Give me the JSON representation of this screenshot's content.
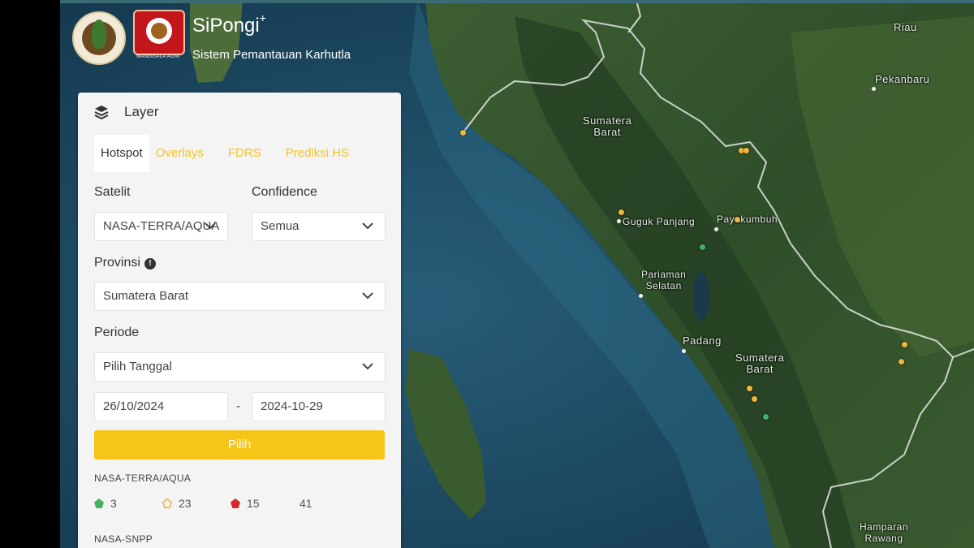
{
  "app": {
    "title": "SiPongi",
    "title_sup": "+",
    "subtitle": "Sistem Pemantauan Karhutla",
    "logo_manggala_caption": "MANGGALA AGNI"
  },
  "panel": {
    "title": "Layer",
    "tabs": [
      {
        "label": "Hotspot",
        "active": true
      },
      {
        "label": "Overlays",
        "active": false
      },
      {
        "label": "FDRS",
        "active": false
      },
      {
        "label": "Prediksi HS",
        "active": false
      }
    ],
    "satelit_label": "Satelit",
    "satelit_value": "NASA-TERRA/AQUA",
    "confidence_label": "Confidence",
    "confidence_value": "Semua",
    "provinsi_label": "Provinsi",
    "provinsi_value": "Sumatera Barat",
    "periode_label": "Periode",
    "periode_value": "Pilih Tanggal",
    "date_from": "26/10/2024",
    "date_separator": "-",
    "date_to": "2024-10-29",
    "submit_label": "Pilih",
    "summaries": [
      {
        "satellite": "NASA-TERRA/AQUA",
        "low": "3",
        "medium": "23",
        "high": "15",
        "total": "41"
      },
      {
        "satellite": "NASA-SNPP"
      }
    ]
  },
  "map": {
    "labels": {
      "riau": "Riau",
      "pekanbaru": "Pekanbaru",
      "sumbar_north": "Sumatera\nBarat",
      "guguk_panjang": "Guguk Panjang",
      "payakumbuh": "Payakumbuh",
      "pariaman_selatan": "Pariaman\nSelatan",
      "padang": "Padang",
      "sumbar_south": "Sumatera\nBarat",
      "hamparan_rawang": "Hamparan\nRawang"
    }
  },
  "colors": {
    "accent": "#f5c518",
    "confidence_low": "#48b065",
    "confidence_medium": "#f2b63c",
    "confidence_high": "#d62828"
  },
  "icons": [
    "layers-icon",
    "info-icon",
    "chevron-down-icon"
  ]
}
